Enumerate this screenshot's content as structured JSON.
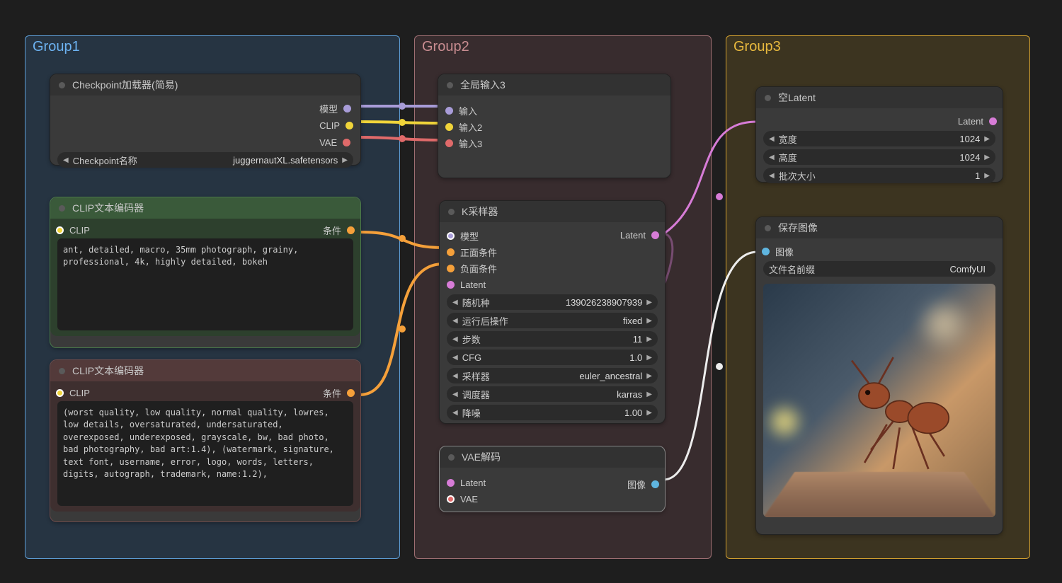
{
  "groups": {
    "g1": "Group1",
    "g2": "Group2",
    "g3": "Group3"
  },
  "n1": {
    "title": "Checkpoint加载器(简易)",
    "out_model": "模型",
    "out_clip": "CLIP",
    "out_vae": "VAE",
    "w_name": "Checkpoint名称",
    "w_val": "juggernautXL.safetensors"
  },
  "n2": {
    "title": "CLIP文本编码器",
    "in": "CLIP",
    "out": "条件",
    "text": "ant, detailed, macro, 35mm photograph, grainy, professional, 4k, highly detailed, bokeh"
  },
  "n3": {
    "title": "CLIP文本编码器",
    "in": "CLIP",
    "out": "条件",
    "text": "(worst quality, low quality, normal quality, lowres, low details, oversaturated, undersaturated, overexposed, underexposed, grayscale, bw, bad photo, bad photography, bad art:1.4), (watermark, signature, text font, username, error, logo, words, letters, digits, autograph, trademark, name:1.2),"
  },
  "n4": {
    "title": "全局输入3",
    "in1": "输入",
    "in2": "输入2",
    "in3": "输入3"
  },
  "n5": {
    "title": "K采样器",
    "in_model": "模型",
    "in_pos": "正面条件",
    "in_neg": "负面条件",
    "in_lat": "Latent",
    "out_lat": "Latent",
    "seed_l": "随机种",
    "seed_v": "139026238907939",
    "after_l": "运行后操作",
    "after_v": "fixed",
    "steps_l": "步数",
    "steps_v": "11",
    "cfg_l": "CFG",
    "cfg_v": "1.0",
    "samp_l": "采样器",
    "samp_v": "euler_ancestral",
    "sched_l": "调度器",
    "sched_v": "karras",
    "denoise_l": "降噪",
    "denoise_v": "1.00"
  },
  "n6": {
    "title": "VAE解码",
    "in_lat": "Latent",
    "in_vae": "VAE",
    "out": "图像"
  },
  "n7": {
    "title": "空Latent",
    "out": "Latent",
    "w_l": "宽度",
    "w_v": "1024",
    "h_l": "高度",
    "h_v": "1024",
    "b_l": "批次大小",
    "b_v": "1"
  },
  "n8": {
    "title": "保存图像",
    "in": "图像",
    "pref_l": "文件名前缀",
    "pref_v": "ComfyUI"
  }
}
